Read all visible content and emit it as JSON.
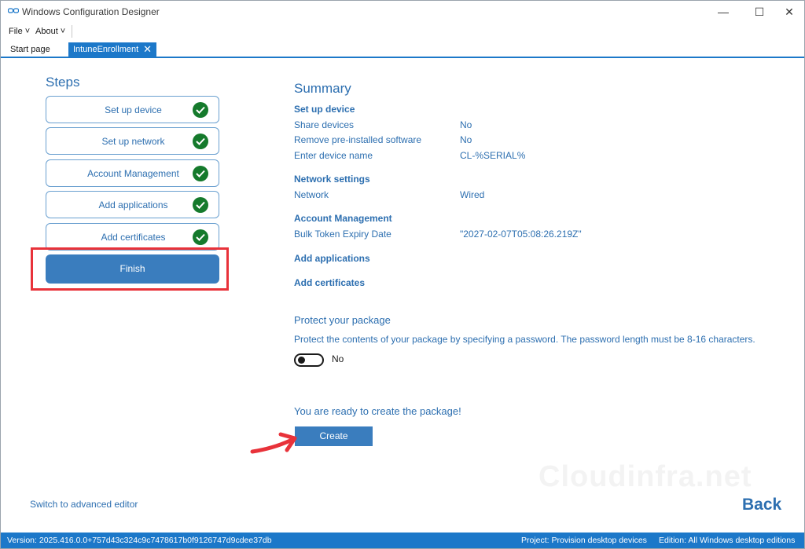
{
  "window": {
    "title": "Windows Configuration Designer",
    "minimize_glyph": "—",
    "maximize_glyph": "☐",
    "close_glyph": "✕"
  },
  "menu": {
    "file_label": "File ˅",
    "about_label": "About ˅"
  },
  "tabs": {
    "start_label": "Start page",
    "active_label": "IntuneEnrollment",
    "close_glyph": "✕"
  },
  "steps": {
    "heading": "Steps",
    "items": [
      {
        "label": "Set up device",
        "status": "complete"
      },
      {
        "label": "Set up network",
        "status": "complete"
      },
      {
        "label": "Account Management",
        "status": "complete"
      },
      {
        "label": "Add applications",
        "status": "complete"
      },
      {
        "label": "Add certificates",
        "status": "complete"
      }
    ],
    "finish_label": "Finish"
  },
  "summary": {
    "title": "Summary",
    "sections": [
      {
        "heading": "Set up device",
        "rows": [
          {
            "label": "Share devices",
            "value": "No"
          },
          {
            "label": "Remove pre-installed software",
            "value": "No"
          },
          {
            "label": "Enter device name",
            "value": "CL-%SERIAL%"
          }
        ]
      },
      {
        "heading": "Network settings",
        "rows": [
          {
            "label": "Network",
            "value": "Wired"
          }
        ]
      },
      {
        "heading": "Account Management",
        "rows": [
          {
            "label": "Bulk Token Expiry Date",
            "value": "\"2027-02-07T05:08:26.219Z\""
          }
        ]
      },
      {
        "heading": "Add applications",
        "rows": []
      },
      {
        "heading": "Add certificates",
        "rows": []
      }
    ]
  },
  "protect": {
    "heading": "Protect your package",
    "description": "Protect the contents of your package by specifying a password. The password length must be 8-16 characters.",
    "toggle_label": "No",
    "toggle_on": false
  },
  "ready": {
    "text": "You are ready to create the package!",
    "create_label": "Create"
  },
  "watermark": "Cloudinfra.net",
  "footer": {
    "advanced_link": "Switch to advanced editor",
    "back_label": "Back"
  },
  "status": {
    "version": "Version: 2025.416.0.0+757d43c324c9c7478617b0f9126747d9cdee37db",
    "project": "Project: Provision desktop devices",
    "edition": "Edition: All Windows desktop editions"
  },
  "colors": {
    "accent": "#1c78c9",
    "button": "#3a7dbe",
    "text_blue": "#2d6fb0",
    "check_green": "#157a2c",
    "highlight_red": "#e8323a"
  }
}
